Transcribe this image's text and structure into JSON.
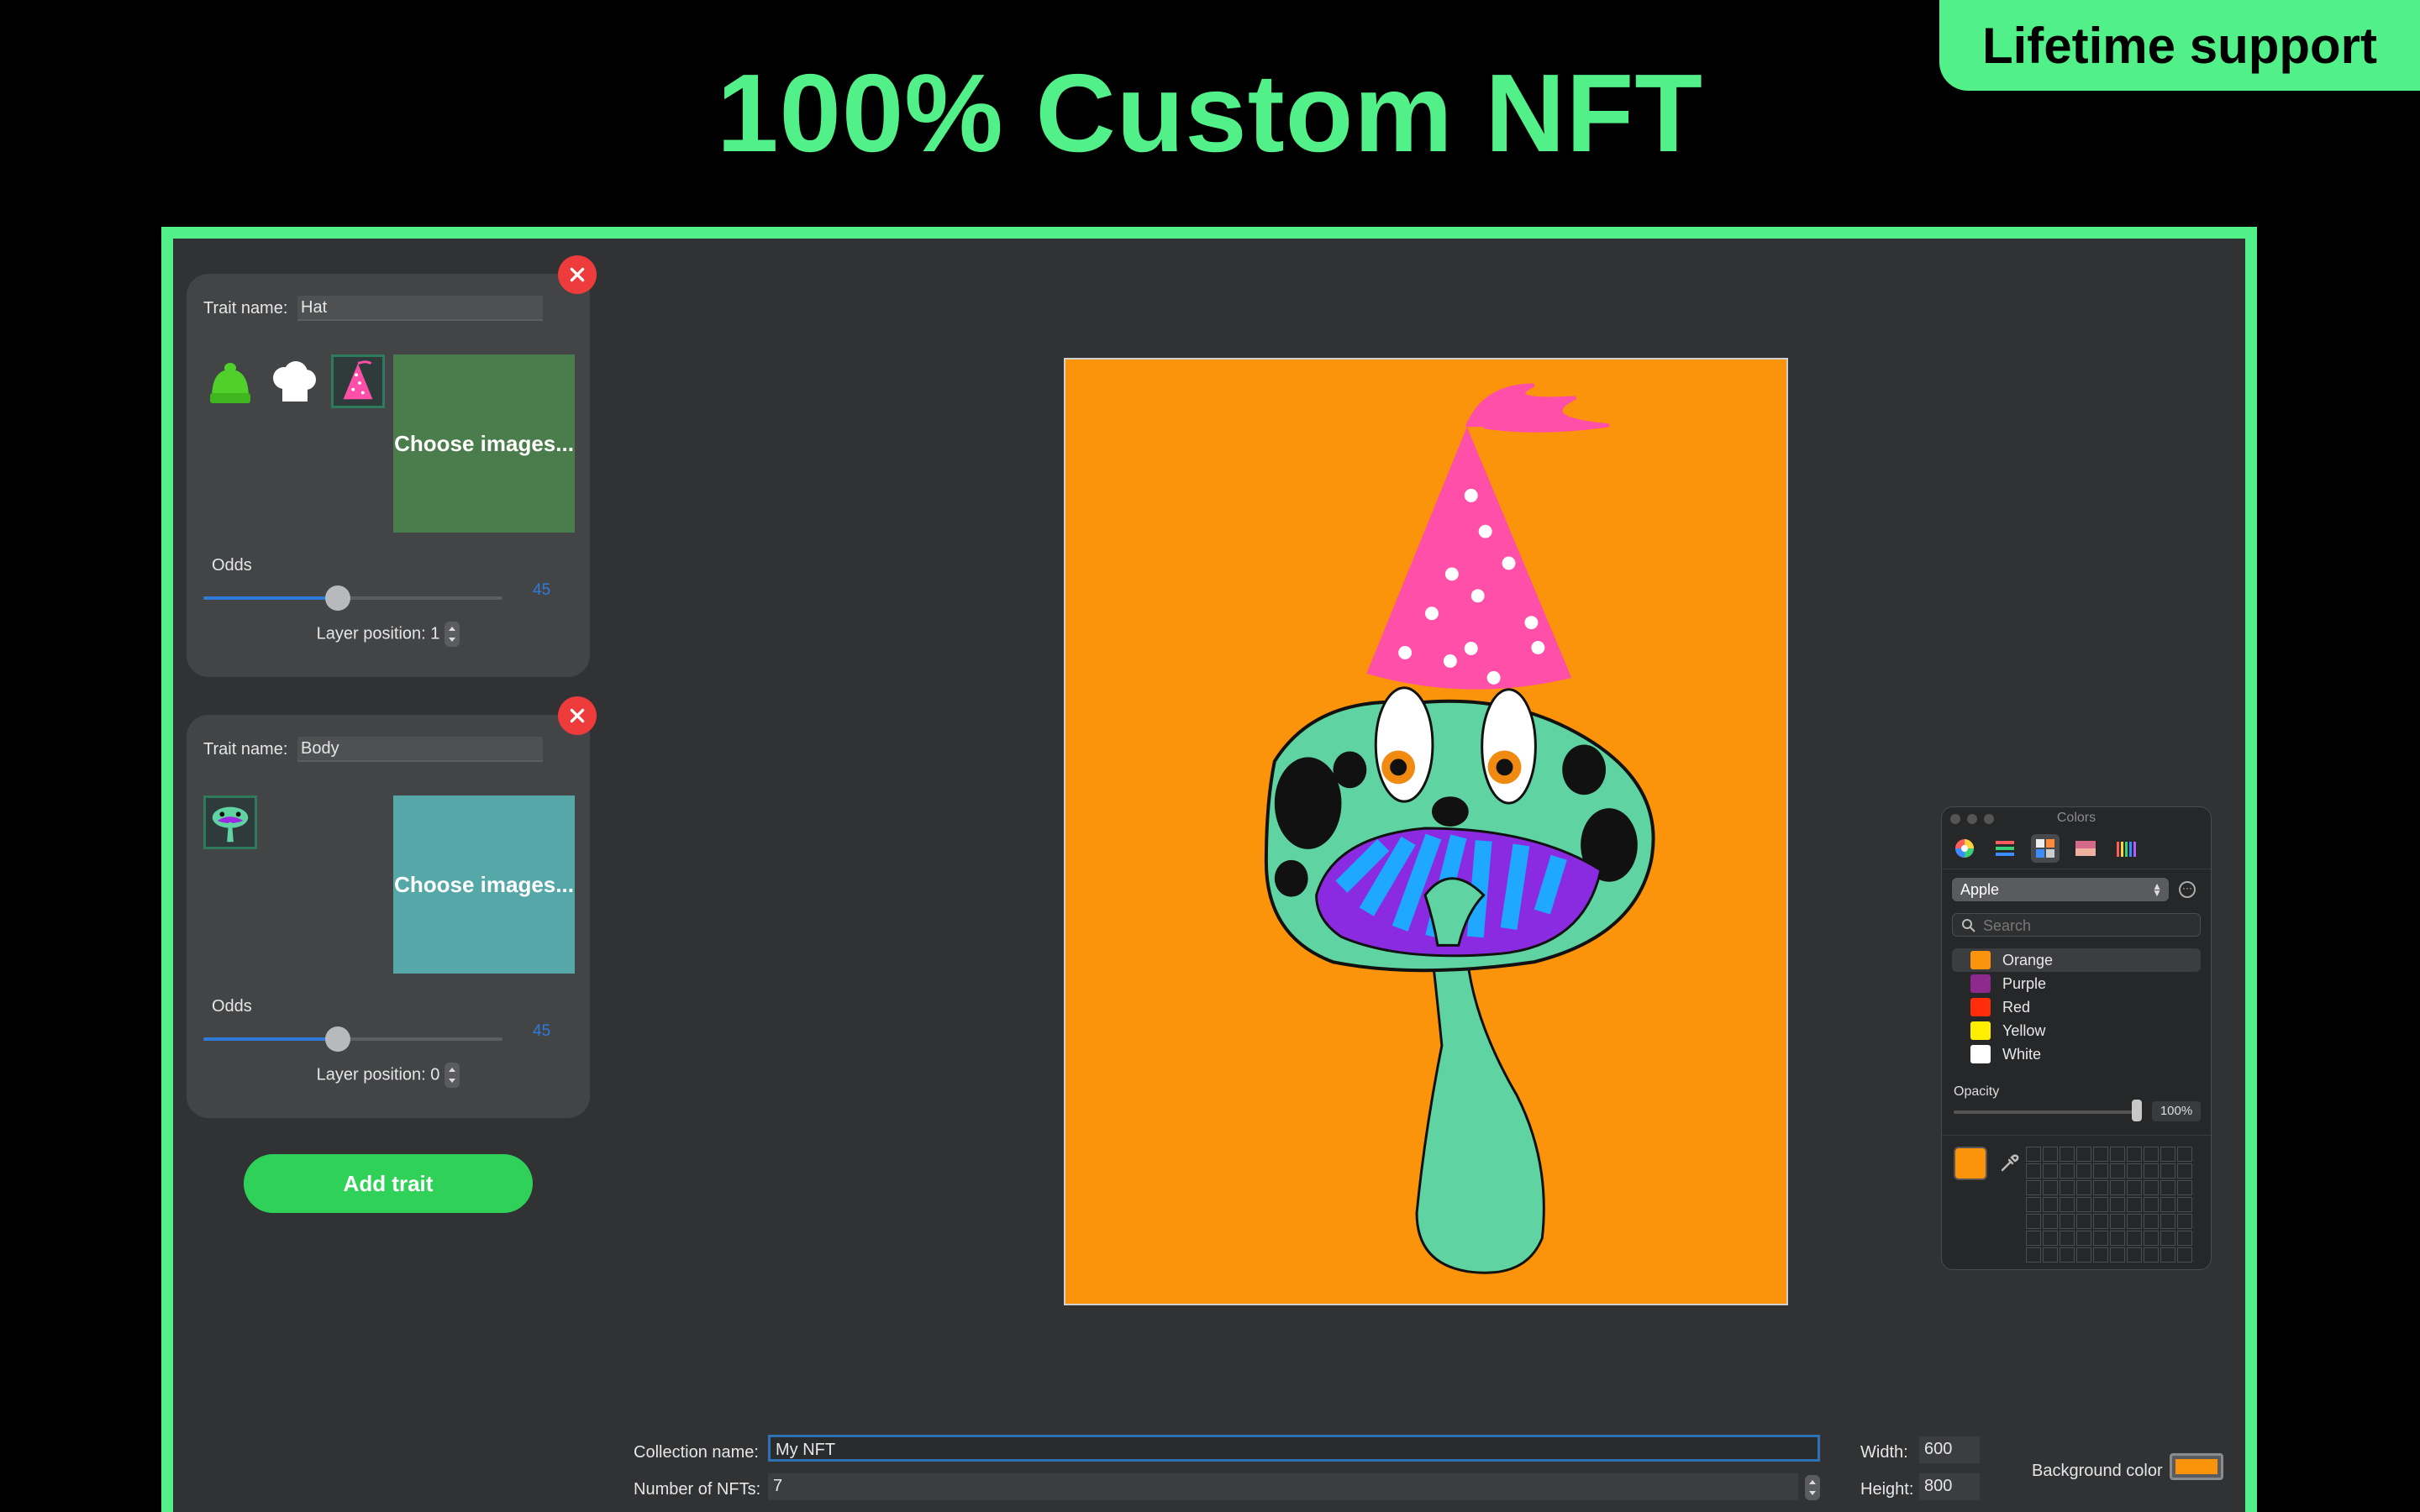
{
  "headline": "100% Custom NFT",
  "badge": "Lifetime support",
  "traits": [
    {
      "name_label": "Trait name:",
      "name_value": "Hat",
      "thumbs": [
        "green-beanie",
        "white-chef-hat",
        "pink-party-hat"
      ],
      "choose_label": "Choose images...",
      "odds_label": "Odds",
      "odds_value": "45",
      "odds_fraction": 0.45,
      "layer_label": "Layer position: 1"
    },
    {
      "name_label": "Trait name:",
      "name_value": "Body",
      "thumbs": [
        "mushroom-body"
      ],
      "choose_label": "Choose images...",
      "odds_label": "Odds",
      "odds_value": "45",
      "odds_fraction": 0.45,
      "layer_label": "Layer position: 0"
    }
  ],
  "add_trait_label": "Add trait",
  "colors_panel": {
    "title": "Colors",
    "palette": "Apple",
    "search_placeholder": "Search",
    "items": [
      {
        "name": "Orange",
        "color": "#fb940a"
      },
      {
        "name": "Purple",
        "color": "#8e2a8e"
      },
      {
        "name": "Red",
        "color": "#ff2d0a"
      },
      {
        "name": "Yellow",
        "color": "#ffee00"
      },
      {
        "name": "White",
        "color": "#ffffff"
      }
    ],
    "opacity_label": "Opacity",
    "opacity_value": "100%",
    "current_color": "#fb940a"
  },
  "bottom": {
    "collection_label": "Collection name:",
    "collection_value": "My NFT",
    "count_label": "Number of NFTs:",
    "count_value": "7",
    "width_label": "Width:",
    "width_value": "600",
    "height_label": "Height:",
    "height_value": "800",
    "bg_label": "Background color",
    "bg_color": "#fb940a"
  },
  "colors": {
    "accent": "#52f088",
    "canvas_bg": "#fb940a",
    "add_button": "#30d158"
  }
}
